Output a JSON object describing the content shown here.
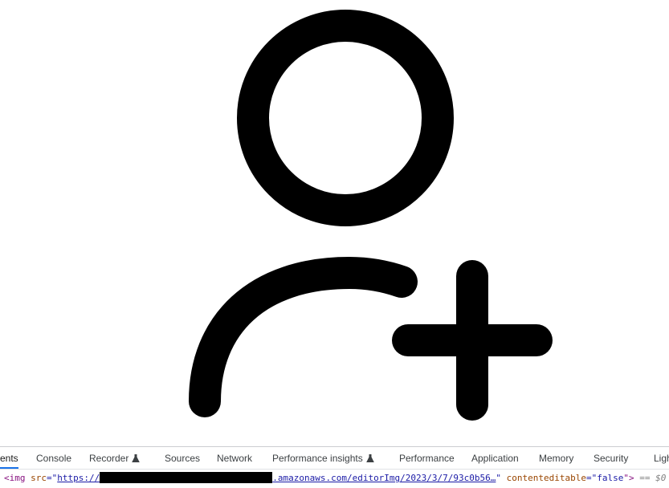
{
  "icon": {
    "name": "user-plus-icon",
    "color": "#000000"
  },
  "devtools": {
    "tabs": [
      {
        "label": "ents",
        "active": true
      },
      {
        "label": "Console"
      },
      {
        "label": "Recorder",
        "experimental": true
      },
      {
        "label": "Sources"
      },
      {
        "label": "Network"
      },
      {
        "label": "Performance insights",
        "experimental": true
      },
      {
        "label": "Performance"
      },
      {
        "label": "Application"
      },
      {
        "label": "Memory"
      },
      {
        "label": "Security"
      },
      {
        "label": "Ligh"
      }
    ],
    "accent_color": "#1a73e8"
  },
  "breadcrumb": {
    "tag_open": "<img",
    "attr_src": "src",
    "eq_quote": "=\"",
    "url_start": "https://",
    "url_rest": ".amazonaws.com/editorImg/2023/3/7/93c0b56…",
    "close_quote": "\"",
    "attr_contenteditable": "contenteditable",
    "eq_quote2": "=\"",
    "contenteditable_value": "false",
    "tag_close": "\">",
    "selected_marker": "== $0"
  }
}
